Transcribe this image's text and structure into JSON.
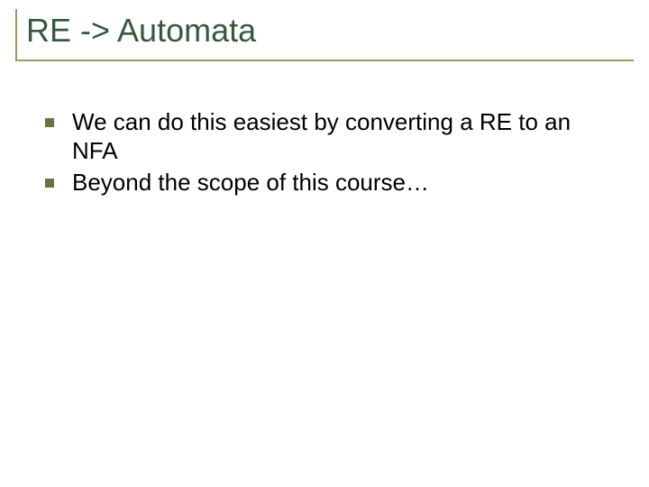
{
  "title": "RE -> Automata",
  "bullets": [
    "We can do this easiest by converting a RE to an NFA",
    "Beyond the scope of this course…"
  ]
}
